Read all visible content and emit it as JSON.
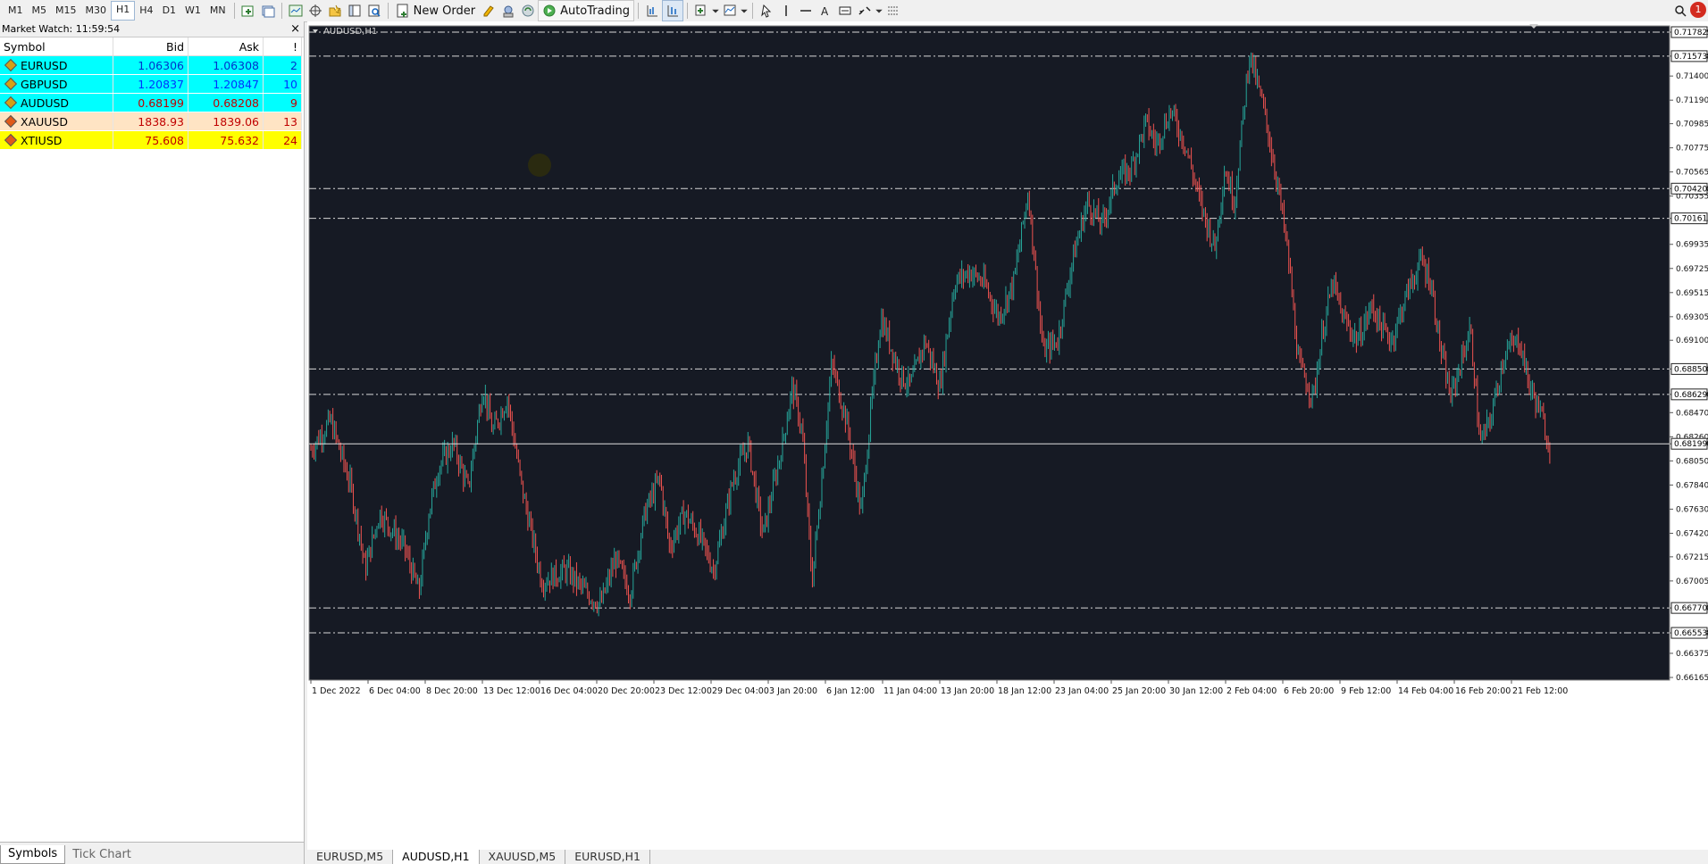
{
  "toolbar": {
    "timeframes": [
      "M1",
      "M5",
      "M15",
      "M30",
      "H1",
      "H4",
      "D1",
      "W1",
      "MN"
    ],
    "active_timeframe": "H1",
    "new_order_label": "New Order",
    "autotrading_label": "AutoTrading",
    "notification_count": "1"
  },
  "market_watch": {
    "title": "Market Watch: 11:59:54",
    "columns": [
      "Symbol",
      "Bid",
      "Ask",
      "!"
    ],
    "rows": [
      {
        "symbol": "EURUSD",
        "bid": "1.06306",
        "ask": "1.06308",
        "spread": "2",
        "bg": "#00ffff",
        "color": "#0033cc"
      },
      {
        "symbol": "GBPUSD",
        "bid": "1.20837",
        "ask": "1.20847",
        "spread": "10",
        "bg": "#00ffff",
        "color": "#0033ff"
      },
      {
        "symbol": "AUDUSD",
        "bid": "0.68199",
        "ask": "0.68208",
        "spread": "9",
        "bg": "#00ffff",
        "color": "#c00000"
      },
      {
        "symbol": "XAUUSD",
        "bid": "1838.93",
        "ask": "1839.06",
        "spread": "13",
        "bg": "#ffe4c4",
        "color": "#c00000"
      },
      {
        "symbol": "XTIUSD",
        "bid": "75.608",
        "ask": "75.632",
        "spread": "24",
        "bg": "#ffff00",
        "color": "#c00000"
      }
    ],
    "tabs": [
      "Symbols",
      "Tick Chart"
    ]
  },
  "chart": {
    "label": "AUDUSD,H1",
    "bg": "#161a24",
    "bull_color": "#26a69a",
    "bear_color": "#ef5350",
    "price_ticks": [
      "0.71782",
      "0.71573",
      "0.71400",
      "0.71190",
      "0.70985",
      "0.70775",
      "0.70565",
      "0.70420",
      "0.70355",
      "0.70161",
      "0.69935",
      "0.69725",
      "0.69515",
      "0.69305",
      "0.69100",
      "0.68850",
      "0.68629",
      "0.68470",
      "0.68260",
      "0.68199",
      "0.68050",
      "0.67840",
      "0.67630",
      "0.67420",
      "0.67215",
      "0.67005",
      "0.66770",
      "0.66553",
      "0.66375",
      "0.66165"
    ],
    "levels": [
      "0.71782",
      "0.71573",
      "0.70420",
      "0.70161",
      "0.68850",
      "0.68629",
      "0.66770",
      "0.66553"
    ],
    "current_price": "0.68199",
    "time_ticks": [
      "1 Dec 2022",
      "6 Dec 04:00",
      "8 Dec 20:00",
      "13 Dec 12:00",
      "16 Dec 04:00",
      "20 Dec 20:00",
      "23 Dec 12:00",
      "29 Dec 04:00",
      "3 Jan 20:00",
      "6 Jan 12:00",
      "11 Jan 04:00",
      "13 Jan 20:00",
      "18 Jan 12:00",
      "23 Jan 04:00",
      "25 Jan 20:00",
      "30 Jan 12:00",
      "2 Feb 04:00",
      "6 Feb 20:00",
      "9 Feb 12:00",
      "14 Feb 04:00",
      "16 Feb 20:00",
      "21 Feb 12:00"
    ]
  },
  "chart_data": {
    "type": "candlestick",
    "symbol": "AUDUSD",
    "timeframe": "H1",
    "ylim": [
      0.66165,
      0.71782
    ],
    "x": [
      "1 Dec 2022",
      "6 Dec 04:00",
      "8 Dec 20:00",
      "13 Dec 12:00",
      "16 Dec 04:00",
      "20 Dec 20:00",
      "23 Dec 12:00",
      "29 Dec 04:00",
      "3 Jan 20:00",
      "6 Jan 12:00",
      "11 Jan 04:00",
      "13 Jan 20:00",
      "18 Jan 12:00",
      "23 Jan 04:00",
      "25 Jan 20:00",
      "30 Jan 12:00",
      "2 Feb 04:00",
      "6 Feb 20:00",
      "9 Feb 12:00",
      "14 Feb 04:00",
      "16 Feb 20:00",
      "21 Feb 12:00"
    ],
    "close": [
      0.68,
      0.67,
      0.678,
      0.687,
      0.67,
      0.668,
      0.674,
      0.678,
      0.673,
      0.693,
      0.688,
      0.699,
      0.689,
      0.703,
      0.712,
      0.706,
      0.714,
      0.688,
      0.697,
      0.696,
      0.683,
      0.682
    ]
  },
  "bottom_tabs": [
    "EURUSD,M5",
    "AUDUSD,H1",
    "XAUUSD,M5",
    "EURUSD,H1"
  ],
  "bottom_tab_active": 1
}
